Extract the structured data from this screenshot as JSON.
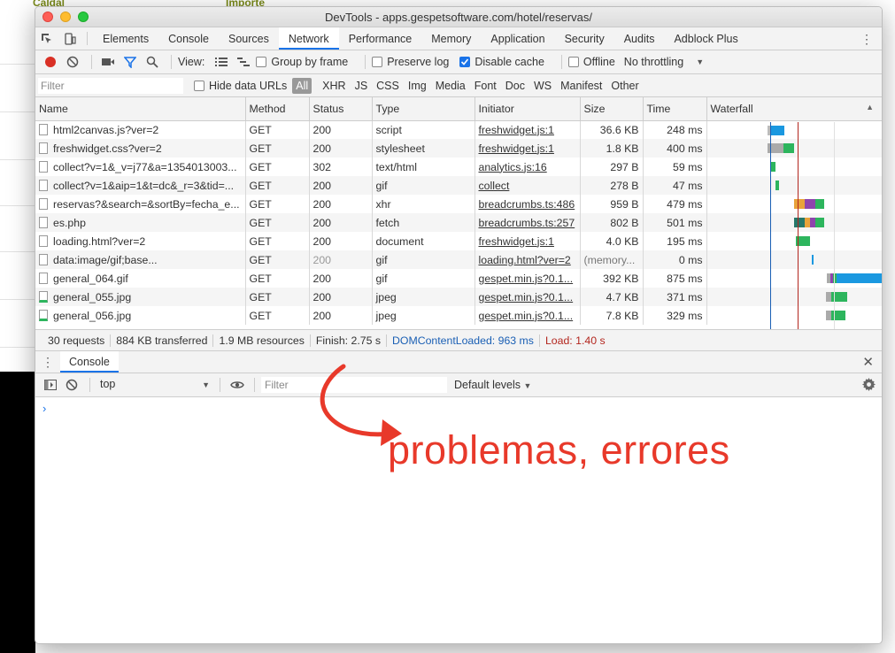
{
  "background": {
    "top_texts": [
      "Caldal",
      "Importe"
    ]
  },
  "window": {
    "title": "DevTools - apps.gespetsoftware.com/hotel/reservas/"
  },
  "tabs": [
    "Elements",
    "Console",
    "Sources",
    "Network",
    "Performance",
    "Memory",
    "Application",
    "Security",
    "Audits",
    "Adblock Plus"
  ],
  "active_tab": "Network",
  "toolbar": {
    "view_label": "View:",
    "group_by_frame": "Group by frame",
    "preserve_log": "Preserve log",
    "disable_cache": "Disable cache",
    "offline": "Offline",
    "throttling": "No throttling"
  },
  "filterbar": {
    "placeholder": "Filter",
    "hide_data_urls": "Hide data URLs",
    "types": [
      "All",
      "XHR",
      "JS",
      "CSS",
      "Img",
      "Media",
      "Font",
      "Doc",
      "WS",
      "Manifest",
      "Other"
    ]
  },
  "table": {
    "headers": [
      "Name",
      "Method",
      "Status",
      "Type",
      "Initiator",
      "Size",
      "Time",
      "Waterfall"
    ],
    "rows": [
      {
        "name": "html2canvas.js?ver=2",
        "method": "GET",
        "status": "200",
        "type": "script",
        "initiator": "freshwidget.js:1",
        "size": "36.6 KB",
        "time": "248 ms"
      },
      {
        "name": "freshwidget.css?ver=2",
        "method": "GET",
        "status": "200",
        "type": "stylesheet",
        "initiator": "freshwidget.js:1",
        "size": "1.8 KB",
        "time": "400 ms"
      },
      {
        "name": "collect?v=1&_v=j77&a=1354013003...",
        "method": "GET",
        "status": "302",
        "type": "text/html",
        "initiator": "analytics.js:16",
        "size": "297 B",
        "time": "59 ms"
      },
      {
        "name": "collect?v=1&aip=1&t=dc&_r=3&tid=...",
        "method": "GET",
        "status": "200",
        "type": "gif",
        "initiator": "collect",
        "size": "278 B",
        "time": "47 ms"
      },
      {
        "name": "reservas?&search=&sortBy=fecha_e...",
        "method": "GET",
        "status": "200",
        "type": "xhr",
        "initiator": "breadcrumbs.ts:486",
        "size": "959 B",
        "time": "479 ms"
      },
      {
        "name": "es.php",
        "method": "GET",
        "status": "200",
        "type": "fetch",
        "initiator": "breadcrumbs.ts:257",
        "size": "802 B",
        "time": "501 ms"
      },
      {
        "name": "loading.html?ver=2",
        "method": "GET",
        "status": "200",
        "type": "document",
        "initiator": "freshwidget.js:1",
        "size": "4.0 KB",
        "time": "195 ms"
      },
      {
        "name": "data:image/gif;base...",
        "method": "GET",
        "status": "200",
        "type": "gif",
        "initiator": "loading.html?ver=2",
        "size": "(memory...",
        "time": "0 ms"
      },
      {
        "name": "general_064.gif",
        "method": "GET",
        "status": "200",
        "type": "gif",
        "initiator": "gespet.min.js?0.1...",
        "size": "392 KB",
        "time": "875 ms"
      },
      {
        "name": "general_055.jpg",
        "method": "GET",
        "status": "200",
        "type": "jpeg",
        "initiator": "gespet.min.js?0.1...",
        "size": "4.7 KB",
        "time": "371 ms"
      },
      {
        "name": "general_056.jpg",
        "method": "GET",
        "status": "200",
        "type": "jpeg",
        "initiator": "gespet.min.js?0.1...",
        "size": "7.8 KB",
        "time": "329 ms"
      }
    ]
  },
  "status": {
    "requests": "30 requests",
    "transferred": "884 KB transferred",
    "resources": "1.9 MB resources",
    "finish": "Finish: 2.75 s",
    "dcl": "DOMContentLoaded: 963 ms",
    "load": "Load: 1.40 s"
  },
  "drawer": {
    "tab": "Console",
    "context": "top",
    "filter_placeholder": "Filter",
    "levels": "Default levels"
  },
  "annotation": "problemas, errores",
  "colors": {
    "accent": "#1a73e8",
    "dcl": "#1a5fb4",
    "load": "#b3261e",
    "annotation": "#e8392a"
  }
}
